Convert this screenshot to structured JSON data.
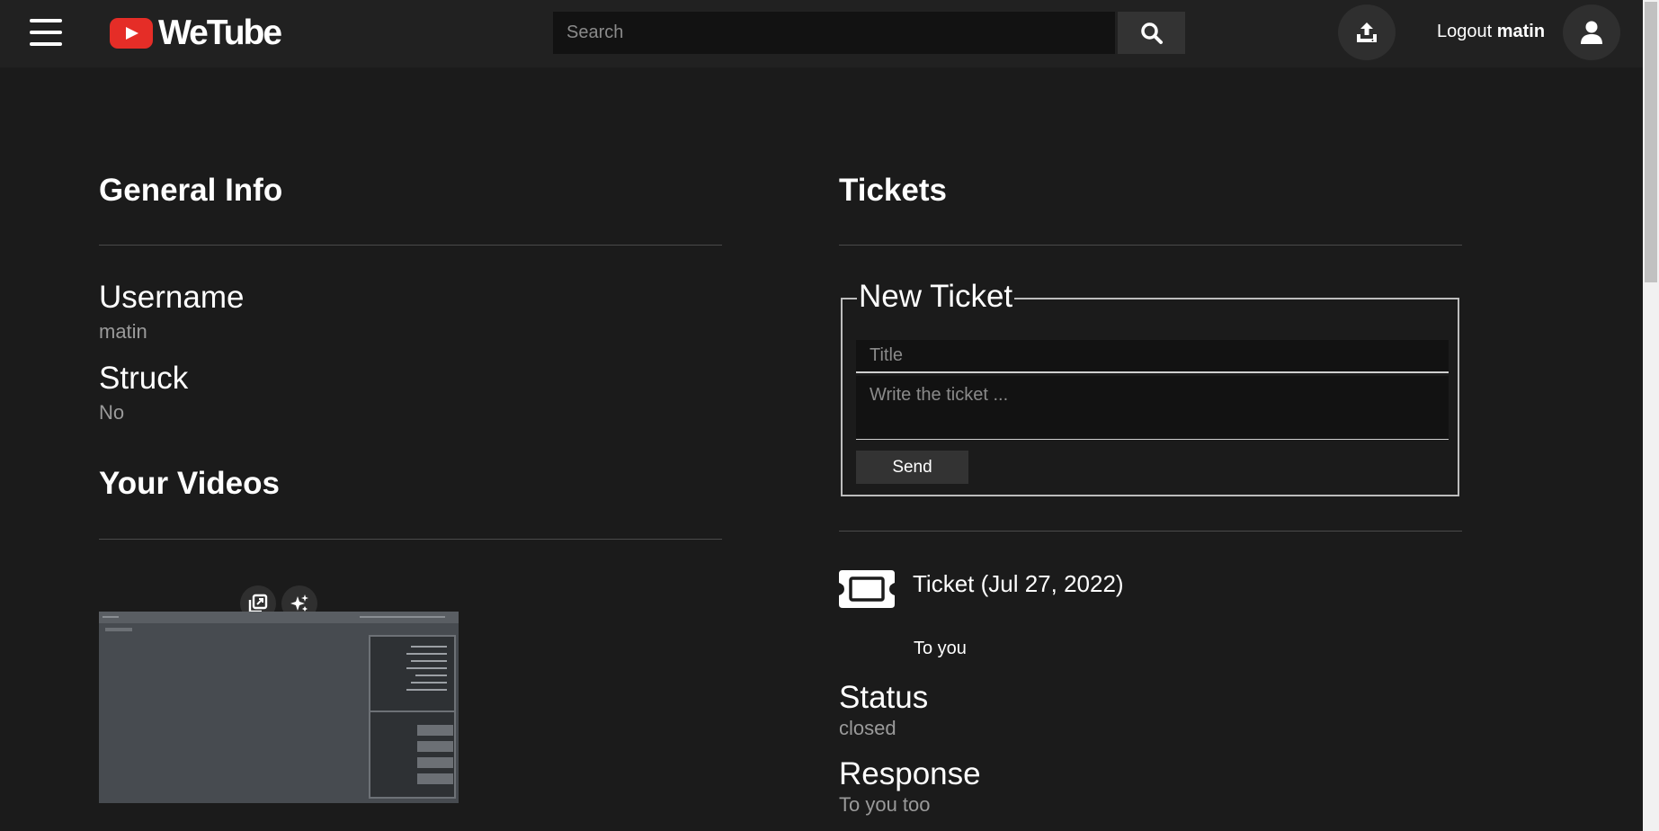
{
  "header": {
    "logo_text": "WeTube",
    "search_placeholder": "Search",
    "logout_label": "Logout",
    "username": "matin"
  },
  "general_info": {
    "heading": "General Info",
    "fields": [
      {
        "label": "Username",
        "value": "matin"
      },
      {
        "label": "Struck",
        "value": "No"
      }
    ]
  },
  "your_videos": {
    "heading": "Your Videos"
  },
  "tickets": {
    "heading": "Tickets",
    "new_ticket": {
      "legend": "New Ticket",
      "title_placeholder": "Title",
      "body_placeholder": "Write the ticket ...",
      "send_label": "Send"
    },
    "items": [
      {
        "title": "Ticket (Jul 27, 2022)",
        "body": "To you",
        "status_label": "Status",
        "status_value": "closed",
        "response_label": "Response",
        "response_value": "To you too"
      }
    ]
  },
  "colors": {
    "background": "#1b1b1b",
    "header": "#212121",
    "logo_red": "#e52d27",
    "muted_text": "#9a9a9a"
  }
}
